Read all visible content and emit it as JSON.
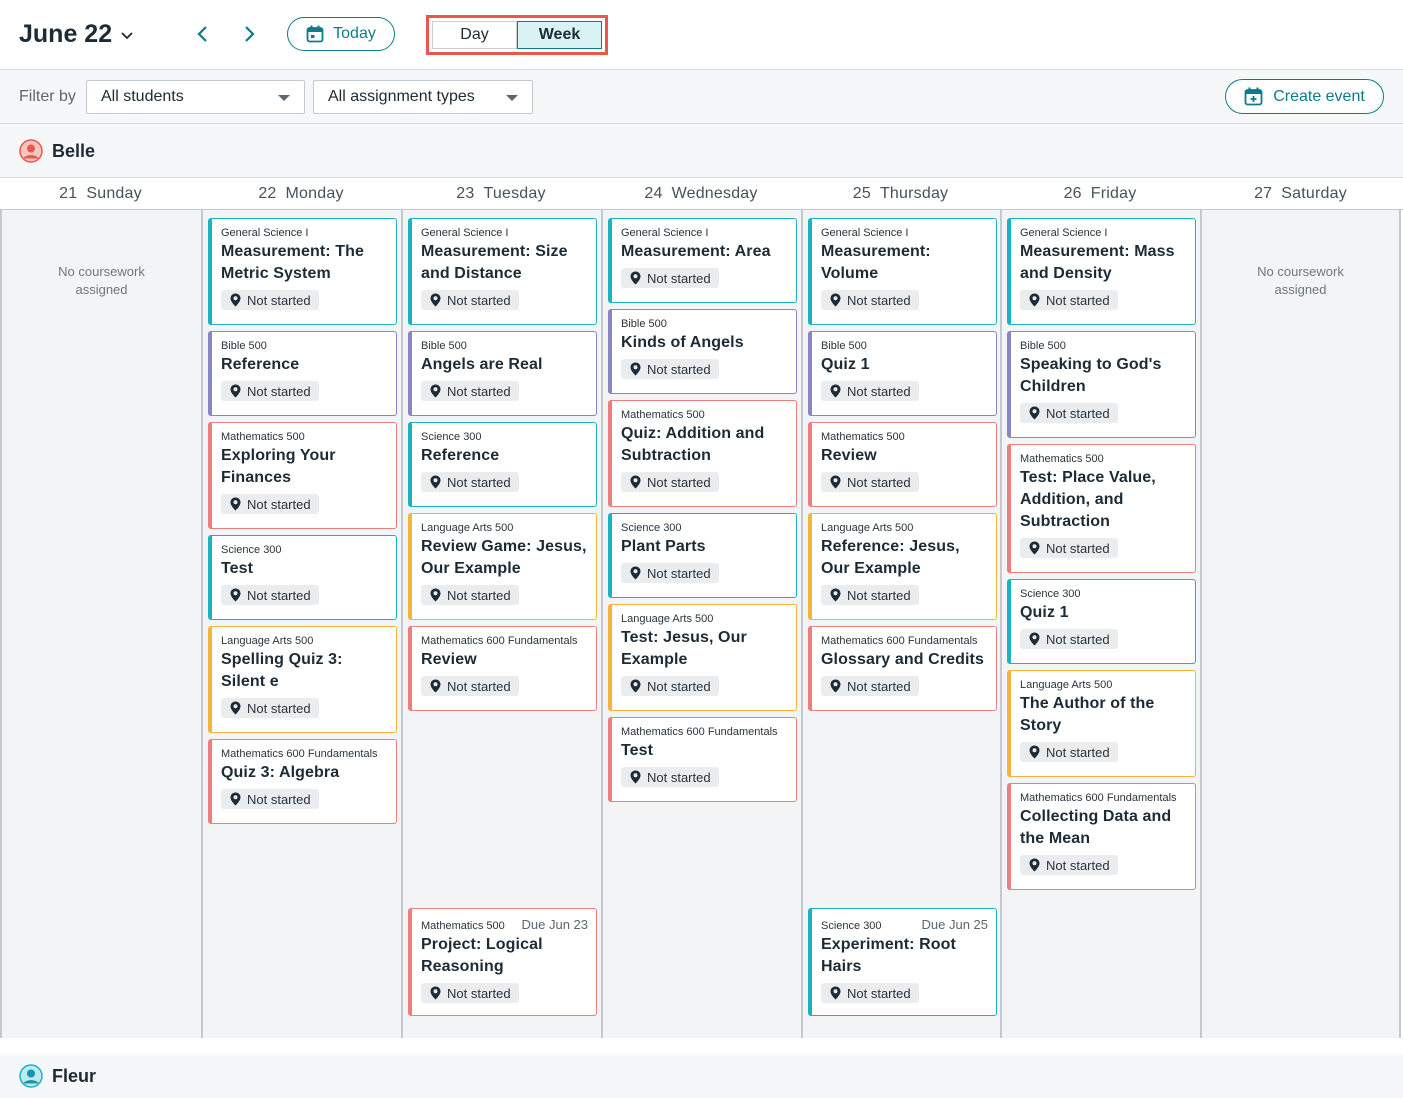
{
  "header": {
    "month_label": "June 22",
    "today_label": "Today",
    "view_day": "Day",
    "view_week": "Week"
  },
  "filters": {
    "label": "Filter by",
    "students_value": "All students",
    "types_value": "All assignment types",
    "create_label": "Create event"
  },
  "students": [
    "Belle",
    "Fleur"
  ],
  "colors": {
    "accent": "#0e7c86",
    "teal": "#1bb3c3",
    "purple": "#8a85c4",
    "red": "#ee7d7d",
    "orange": "#f5b43a",
    "highlight": "#e8584f"
  },
  "days": [
    {
      "num": "21",
      "name": "Sunday",
      "empty": "No coursework\nassigned",
      "cards": []
    },
    {
      "num": "22",
      "name": "Monday",
      "cards": [
        {
          "course": "General Science I",
          "title": "Measurement: The Metric System",
          "status": "Not started",
          "color": "teal"
        },
        {
          "course": "Bible 500",
          "title": "Reference",
          "status": "Not started",
          "color": "purple"
        },
        {
          "course": "Mathematics 500",
          "title": "Exploring Your Finances",
          "status": "Not started",
          "color": "red"
        },
        {
          "course": "Science 300",
          "title": "Test",
          "status": "Not started",
          "color": "teal"
        },
        {
          "course": "Language Arts 500",
          "title": "Spelling Quiz 3: Silent e",
          "status": "Not started",
          "color": "orange"
        },
        {
          "course": "Mathematics 600 Fundamentals",
          "title": "Quiz 3: Algebra",
          "status": "Not started",
          "color": "red"
        }
      ]
    },
    {
      "num": "23",
      "name": "Tuesday",
      "cards": [
        {
          "course": "General Science I",
          "title": "Measurement: Size and Distance",
          "status": "Not started",
          "color": "teal"
        },
        {
          "course": "Bible 500",
          "title": "Angels are Real",
          "status": "Not started",
          "color": "purple"
        },
        {
          "course": "Science 300",
          "title": "Reference",
          "status": "Not started",
          "color": "teal"
        },
        {
          "course": "Language Arts 500",
          "title": "Review Game: Jesus, Our Example",
          "status": "Not started",
          "color": "orange"
        },
        {
          "course": "Mathematics 600 Fundamentals",
          "title": "Review",
          "status": "Not started",
          "color": "red"
        },
        {
          "course": "Mathematics 500",
          "title": "Project: Logical Reasoning",
          "status": "Not started",
          "color": "red",
          "due": "Due Jun 23",
          "bottom": true
        }
      ]
    },
    {
      "num": "24",
      "name": "Wednesday",
      "cards": [
        {
          "course": "General Science I",
          "title": "Measurement: Area",
          "status": "Not started",
          "color": "teal"
        },
        {
          "course": "Bible 500",
          "title": "Kinds of Angels",
          "status": "Not started",
          "color": "purple"
        },
        {
          "course": "Mathematics 500",
          "title": "Quiz: Addition and Subtraction",
          "status": "Not started",
          "color": "red"
        },
        {
          "course": "Science 300",
          "title": "Plant Parts",
          "status": "Not started",
          "color": "teal"
        },
        {
          "course": "Language Arts 500",
          "title": "Test: Jesus, Our Example",
          "status": "Not started",
          "color": "orange"
        },
        {
          "course": "Mathematics 600 Fundamentals",
          "title": "Test",
          "status": "Not started",
          "color": "red"
        }
      ]
    },
    {
      "num": "25",
      "name": "Thursday",
      "cards": [
        {
          "course": "General Science I",
          "title": "Measurement: Volume",
          "status": "Not started",
          "color": "teal"
        },
        {
          "course": "Bible 500",
          "title": "Quiz 1",
          "status": "Not started",
          "color": "purple"
        },
        {
          "course": "Mathematics 500",
          "title": "Review",
          "status": "Not started",
          "color": "red"
        },
        {
          "course": "Language Arts 500",
          "title": "Reference: Jesus, Our Example",
          "status": "Not started",
          "color": "orange"
        },
        {
          "course": "Mathematics 600 Fundamentals",
          "title": "Glossary and Credits",
          "status": "Not started",
          "color": "red"
        },
        {
          "course": "Science 300",
          "title": "Experiment: Root Hairs",
          "status": "Not started",
          "color": "teal",
          "due": "Due Jun 25",
          "bottom": true
        }
      ]
    },
    {
      "num": "26",
      "name": "Friday",
      "cards": [
        {
          "course": "General Science I",
          "title": "Measurement: Mass and Density",
          "status": "Not started",
          "color": "teal"
        },
        {
          "course": "Bible 500",
          "title": "Speaking to God's Children",
          "status": "Not started",
          "color": "purple"
        },
        {
          "course": "Mathematics 500",
          "title": "Test: Place Value, Addition, and Subtraction",
          "status": "Not started",
          "color": "red"
        },
        {
          "course": "Science 300",
          "title": "Quiz 1",
          "status": "Not started",
          "color": "teal"
        },
        {
          "course": "Language Arts 500",
          "title": "The Author of the Story",
          "status": "Not started",
          "color": "orange"
        },
        {
          "course": "Mathematics 600 Fundamentals",
          "title": "Collecting Data and the Mean",
          "status": "Not started",
          "color": "red"
        }
      ]
    },
    {
      "num": "27",
      "name": "Saturday",
      "empty": "No coursework\nassigned",
      "cards": []
    }
  ]
}
